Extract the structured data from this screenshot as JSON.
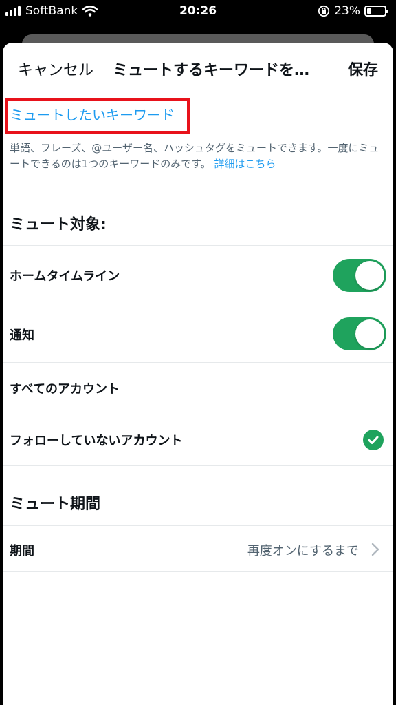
{
  "status_bar": {
    "carrier": "SoftBank",
    "time": "20:26",
    "battery": "23%",
    "battery_level": 0.23
  },
  "nav": {
    "cancel_label": "キャンセル",
    "title": "ミュートするキーワードを…",
    "save_label": "保存"
  },
  "keyword": {
    "placeholder": "ミュートしたいキーワード",
    "value": ""
  },
  "help": {
    "text": "単語、フレーズ、@ユーザー名、ハッシュタグをミュートできます。一度にミュートできるのは1つのキーワードのみです。",
    "link": "詳細はこちら"
  },
  "mute_from": {
    "heading": "ミュート対象:",
    "home_timeline": {
      "label": "ホームタイムライン",
      "enabled": true
    },
    "notifications": {
      "label": "通知",
      "enabled": true
    },
    "accounts": {
      "all": {
        "label": "すべてのアカウント",
        "selected": false
      },
      "not_following": {
        "label": "フォローしていないアカウント",
        "selected": true
      }
    }
  },
  "duration": {
    "heading": "ミュート期間",
    "label": "期間",
    "value": "再度オンにするまで"
  },
  "colors": {
    "accent": "#1d9bf0",
    "toggle_on": "#1fa35d",
    "highlight": "#e8121b"
  }
}
